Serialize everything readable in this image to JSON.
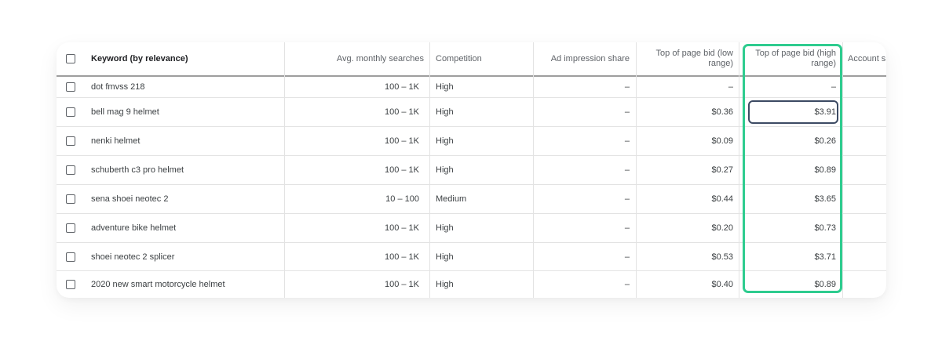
{
  "columns": {
    "keyword": "Keyword (by relevance)",
    "searches": "Avg. monthly searches",
    "competition": "Competition",
    "impression": "Ad impression share",
    "low_bid": "Top of page bid (low range)",
    "high_bid": "Top of page bid (high range)",
    "account": "Account s"
  },
  "rows": [
    {
      "keyword": "dot fmvss 218",
      "searches": "100 – 1K",
      "competition": "High",
      "impression": "–",
      "low_bid": "–",
      "high_bid": "–"
    },
    {
      "keyword": "bell mag 9 helmet",
      "searches": "100 – 1K",
      "competition": "High",
      "impression": "–",
      "low_bid": "$0.36",
      "high_bid": "$3.91"
    },
    {
      "keyword": "nenki helmet",
      "searches": "100 – 1K",
      "competition": "High",
      "impression": "–",
      "low_bid": "$0.09",
      "high_bid": "$0.26"
    },
    {
      "keyword": "schuberth c3 pro helmet",
      "searches": "100 – 1K",
      "competition": "High",
      "impression": "–",
      "low_bid": "$0.27",
      "high_bid": "$0.89"
    },
    {
      "keyword": "sena shoei neotec 2",
      "searches": "10 – 100",
      "competition": "Medium",
      "impression": "–",
      "low_bid": "$0.44",
      "high_bid": "$3.65"
    },
    {
      "keyword": "adventure bike helmet",
      "searches": "100 – 1K",
      "competition": "High",
      "impression": "–",
      "low_bid": "$0.20",
      "high_bid": "$0.73"
    },
    {
      "keyword": "shoei neotec 2 splicer",
      "searches": "100 – 1K",
      "competition": "High",
      "impression": "–",
      "low_bid": "$0.53",
      "high_bid": "$3.71"
    },
    {
      "keyword": "2020 new smart motorcycle helmet",
      "searches": "100 – 1K",
      "competition": "High",
      "impression": "–",
      "low_bid": "$0.40",
      "high_bid": "$0.89"
    }
  ],
  "colors": {
    "highlight_column": "#2ecc8f",
    "highlight_cell": "#3c4a63"
  }
}
